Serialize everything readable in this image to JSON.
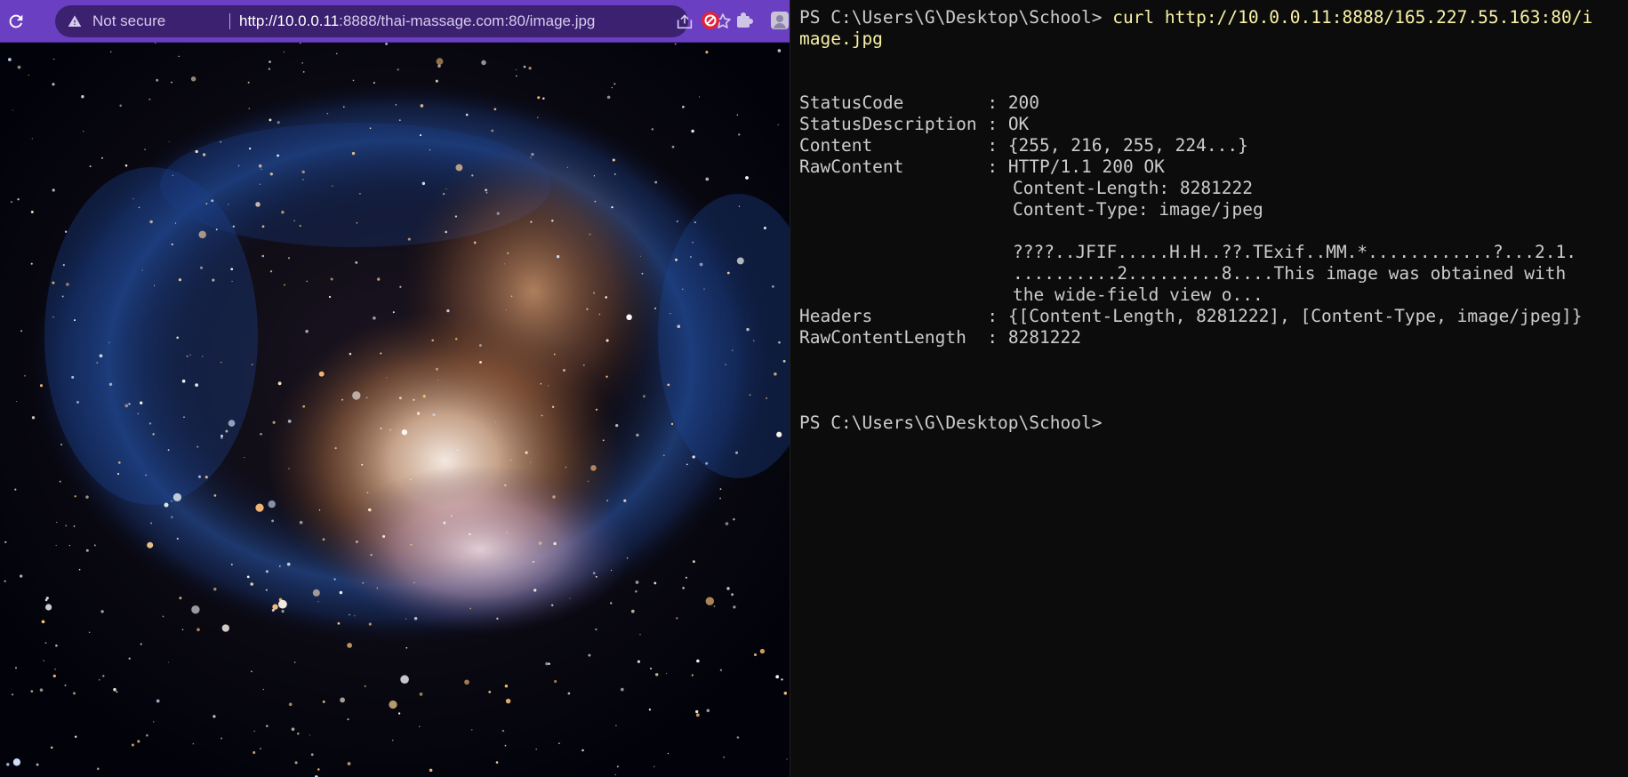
{
  "browser": {
    "security_text": "Not secure",
    "url_host": "http://10.0.0.11",
    "url_rest": ":8888/thai-massage.com:80/image.jpg",
    "accent_color": "#6a3fc1",
    "nav_icons": [
      "refresh-icon"
    ],
    "omnibox_icons": [
      "warning-icon",
      "share-icon",
      "star-icon"
    ],
    "extensions": [
      "red-circle-extension-icon",
      "puzzle-extension-icon",
      "profile-extension-icon"
    ],
    "page_content": "image.jpg (nebula photograph)"
  },
  "terminal": {
    "prompt_line_1": "PS C:\\Users\\G\\Desktop\\School> ",
    "command_1": "curl http://10.0.0.11:8888/165.227.55.163:80/i",
    "command_1_wrap": "mage.jpg",
    "output": [
      {
        "label": "StatusCode        : ",
        "value": "200"
      },
      {
        "label": "StatusDescription : ",
        "value": "OK"
      },
      {
        "label": "Content           : ",
        "value": "{255, 216, 255, 224...}"
      },
      {
        "label": "RawContent        : ",
        "value": "HTTP/1.1 200 OK"
      }
    ],
    "raw_content_lines": [
      "Content-Length: 8281222",
      "Content-Type: image/jpeg",
      "",
      "????..JFIF.....H.H..??.TExif..MM.*............?...2.1.",
      "..........2.........8....This image was obtained with",
      "the wide-field view o..."
    ],
    "headers_label": "Headers           : ",
    "headers_value": "{[Content-Length, 8281222], [Content-Type, image/jpeg]}",
    "raw_length_label": "RawContentLength  : ",
    "raw_length_value": "8281222",
    "prompt_line_2": "PS C:\\Users\\G\\Desktop\\School>",
    "colors": {
      "background": "#0c0c0c",
      "text": "#cccccc",
      "command": "#f9f1a5"
    }
  }
}
